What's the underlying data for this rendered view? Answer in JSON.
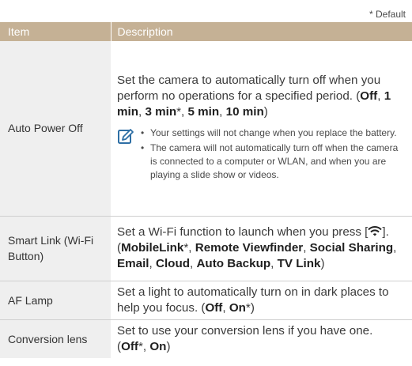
{
  "default_note": "* Default",
  "colors": {
    "header_bg": "#c5b195",
    "item_bg": "#efefef",
    "note_icon": "#2e6fa5"
  },
  "table": {
    "headers": {
      "item": "Item",
      "description": "Description"
    },
    "rows": [
      {
        "item": "Auto Power Off",
        "desc": [
          {
            "t": "Set the camera to automatically turn off when you perform no operations for a specified period. (",
            "b": false
          },
          {
            "t": "Off",
            "b": true
          },
          {
            "t": ", ",
            "b": false
          },
          {
            "t": "1 min",
            "b": true
          },
          {
            "t": ", ",
            "b": false
          },
          {
            "t": "3 min",
            "b": true
          },
          {
            "t": "*, ",
            "b": false
          },
          {
            "t": "5 min",
            "b": true
          },
          {
            "t": ", ",
            "b": false
          },
          {
            "t": "10 min",
            "b": true
          },
          {
            "t": ")",
            "b": false
          }
        ],
        "notes": [
          "Your settings will not change when you replace the battery.",
          "The camera will not automatically turn off when the camera is connected to a computer or WLAN, and when you are playing a slide show or videos."
        ]
      },
      {
        "item": "Smart Link (Wi-Fi Button)",
        "desc_pre": "Set a Wi-Fi function to launch when you press [",
        "desc_icon": "wifi-icon",
        "desc": [
          {
            "t": "]. (",
            "b": false
          },
          {
            "t": "MobileLink",
            "b": true
          },
          {
            "t": "*, ",
            "b": false
          },
          {
            "t": "Remote Viewfinder",
            "b": true
          },
          {
            "t": ", ",
            "b": false
          },
          {
            "t": "Social Sharing",
            "b": true
          },
          {
            "t": ", ",
            "b": false
          },
          {
            "t": "Email",
            "b": true
          },
          {
            "t": ", ",
            "b": false
          },
          {
            "t": "Cloud",
            "b": true
          },
          {
            "t": ", ",
            "b": false
          },
          {
            "t": "Auto Backup",
            "b": true
          },
          {
            "t": ", ",
            "b": false
          },
          {
            "t": "TV Link",
            "b": true
          },
          {
            "t": ")",
            "b": false
          }
        ]
      },
      {
        "item": "AF Lamp",
        "desc": [
          {
            "t": "Set a light to automatically turn on in dark places to help you focus. (",
            "b": false
          },
          {
            "t": "Off",
            "b": true
          },
          {
            "t": ", ",
            "b": false
          },
          {
            "t": "On",
            "b": true
          },
          {
            "t": "*)",
            "b": false
          }
        ]
      },
      {
        "item": "Conversion lens",
        "desc": [
          {
            "t": "Set to use your conversion lens if you have one. (",
            "b": false
          },
          {
            "t": "Off",
            "b": true
          },
          {
            "t": "*, ",
            "b": false
          },
          {
            "t": "On",
            "b": true
          },
          {
            "t": ")",
            "b": false
          }
        ]
      }
    ]
  }
}
